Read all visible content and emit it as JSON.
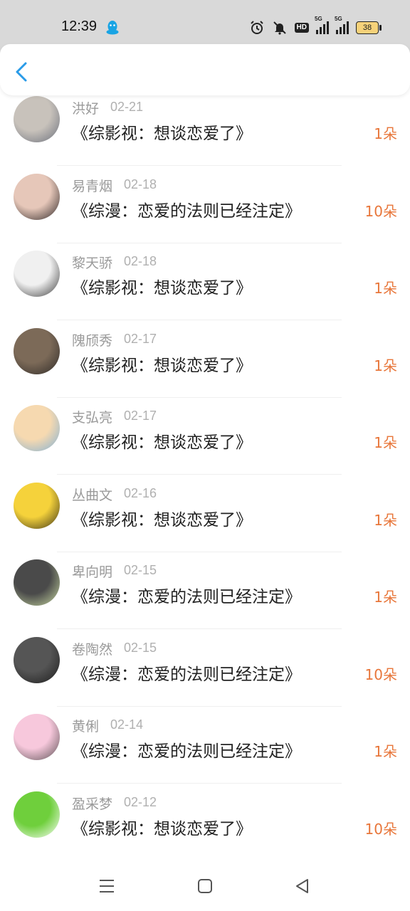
{
  "status_bar": {
    "time": "12:39",
    "icons": [
      "qq-icon",
      "alarm-icon",
      "mute-icon",
      "hd-icon",
      "signal-5g-icon",
      "signal-5g-icon"
    ],
    "hd_label": "HD",
    "network_label": "5G",
    "battery_level": "38"
  },
  "header": {
    "back_icon": "chevron-left-icon",
    "accent_color": "#2a9be8"
  },
  "colors": {
    "amount": "#e8763a",
    "name": "#9a9a9a"
  },
  "items": [
    {
      "name": "洪好",
      "date": "02-21",
      "title": "《综影视：想谈恋爱了》",
      "amount": "1朵",
      "avatar_colors": [
        "#c8c2bb",
        "#6a6f7b"
      ]
    },
    {
      "name": "易青烟",
      "date": "02-18",
      "title": "《综漫：恋爱的法则已经注定》",
      "amount": "10朵",
      "avatar_colors": [
        "#e6c7b9",
        "#2b2424"
      ]
    },
    {
      "name": "黎天骄",
      "date": "02-18",
      "title": "《综影视：想谈恋爱了》",
      "amount": "1朵",
      "avatar_colors": [
        "#f0f0f0",
        "#3a3a3a"
      ]
    },
    {
      "name": "隗颀秀",
      "date": "02-17",
      "title": "《综影视：想谈恋爱了》",
      "amount": "1朵",
      "avatar_colors": [
        "#7c6a58",
        "#2e2a27"
      ]
    },
    {
      "name": "支弘亮",
      "date": "02-17",
      "title": "《综影视：想谈恋爱了》",
      "amount": "1朵",
      "avatar_colors": [
        "#f6d9b0",
        "#7fb0d6"
      ]
    },
    {
      "name": "丛曲文",
      "date": "02-16",
      "title": "《综影视：想谈恋爱了》",
      "amount": "1朵",
      "avatar_colors": [
        "#f5d23b",
        "#3b3216"
      ]
    },
    {
      "name": "卑向明",
      "date": "02-15",
      "title": "《综漫：恋爱的法则已经注定》",
      "amount": "1朵",
      "avatar_colors": [
        "#4a4a4a",
        "#c8d9a2"
      ]
    },
    {
      "name": "卷陶然",
      "date": "02-15",
      "title": "《综漫：恋爱的法则已经注定》",
      "amount": "10朵",
      "avatar_colors": [
        "#555555",
        "#1c1c1c"
      ]
    },
    {
      "name": "黄俐",
      "date": "02-14",
      "title": "《综漫：恋爱的法则已经注定》",
      "amount": "1朵",
      "avatar_colors": [
        "#f7c8dc",
        "#5a5053"
      ]
    },
    {
      "name": "盈采梦",
      "date": "02-12",
      "title": "《综影视：想谈恋爱了》",
      "amount": "10朵",
      "avatar_colors": [
        "#6fcf3c",
        "#ffffff"
      ]
    }
  ],
  "nav": {
    "icons": [
      "menu-icon",
      "home-square-icon",
      "back-triangle-icon"
    ]
  }
}
